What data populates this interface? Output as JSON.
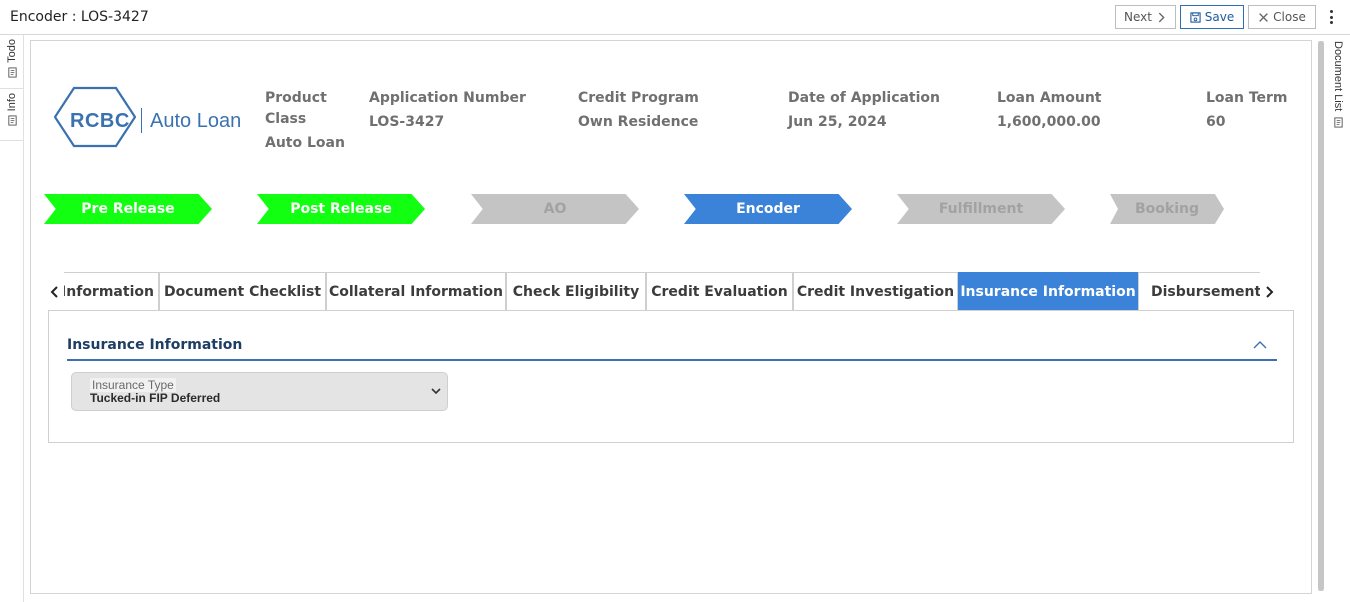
{
  "window": {
    "title": "Encoder : LOS-3427"
  },
  "toolbar": {
    "next_label": "Next",
    "save_label": "Save",
    "close_label": "Close"
  },
  "left_rail": {
    "todo_label": "Todo",
    "info_label": "Info"
  },
  "right_rail": {
    "document_list_label": "Document List"
  },
  "logo": {
    "brand": "RCBC",
    "product": "Auto Loan"
  },
  "header": {
    "product_class": {
      "label_line1": "Product",
      "label_line2": "Class",
      "value": "Auto Loan"
    },
    "application_number": {
      "label": "Application Number",
      "value": "LOS-3427"
    },
    "credit_program": {
      "label": "Credit Program",
      "value": "Own Residence"
    },
    "date_of_application": {
      "label": "Date of Application",
      "value": "Jun 25, 2024"
    },
    "loan_amount": {
      "label": "Loan Amount",
      "value": "1,600,000.00"
    },
    "loan_term": {
      "label": "Loan Term",
      "value": "60"
    }
  },
  "steps": [
    {
      "label": "Pre Release",
      "status": "complete"
    },
    {
      "label": "Post Release",
      "status": "complete"
    },
    {
      "label": "AO",
      "status": "pending"
    },
    {
      "label": "Encoder",
      "status": "current"
    },
    {
      "label": "Fulfillment",
      "status": "pending"
    },
    {
      "label": "Booking",
      "status": "pending"
    }
  ],
  "tabs": [
    {
      "label": "Information"
    },
    {
      "label": "Document Checklist"
    },
    {
      "label": "Collateral Information"
    },
    {
      "label": "Check Eligibility"
    },
    {
      "label": "Credit Evaluation"
    },
    {
      "label": "Credit Investigation"
    },
    {
      "label": "Insurance Information",
      "active": true
    },
    {
      "label": "Disbursement Information"
    }
  ],
  "section": {
    "title": "Insurance Information",
    "insurance_type": {
      "label": "Insurance Type",
      "value": "Tucked-in FIP Deferred"
    }
  },
  "colors": {
    "accent": "#3a83d8",
    "complete_step": "#12ff12",
    "pending_step": "#c4c4c4",
    "brand": "#3a72b0"
  },
  "icons": {
    "next": "chevron-right-icon",
    "save": "save-icon",
    "close": "close-icon",
    "more": "kebab-menu-icon",
    "rail": "document-icon",
    "collapse": "chevron-up-icon",
    "select": "chevron-down-icon"
  }
}
